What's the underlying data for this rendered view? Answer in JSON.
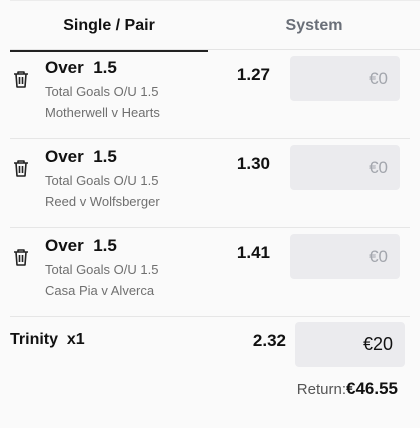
{
  "tabs": [
    {
      "label": "Single / Pair",
      "active": true
    },
    {
      "label": "System",
      "active": false
    }
  ],
  "selections": [
    {
      "title": "Over  1.5",
      "market": "Total Goals O/U 1.5",
      "event": "Motherwell v Hearts",
      "odds": "1.27",
      "stake": "€0",
      "icon": "trash-icon"
    },
    {
      "title": "Over  1.5",
      "market": "Total Goals O/U 1.5",
      "event": "Reed v Wolfsberger",
      "odds": "1.30",
      "stake": "€0",
      "icon": "trash-icon"
    },
    {
      "title": "Over  1.5",
      "market": "Total Goals O/U 1.5",
      "event": "Casa Pia v Alverca",
      "odds": "1.41",
      "stake": "€0",
      "icon": "trash-icon"
    }
  ],
  "combo": {
    "label": "Trinity  x1",
    "odds": "2.32",
    "stake": "€20"
  },
  "returns": {
    "label": "Return:",
    "value": "€46.55"
  },
  "colors": {
    "background": "#fafafa",
    "input_bg": "#ebebee",
    "placeholder": "#a3a6ad",
    "active_tab_underline": "#222222"
  }
}
